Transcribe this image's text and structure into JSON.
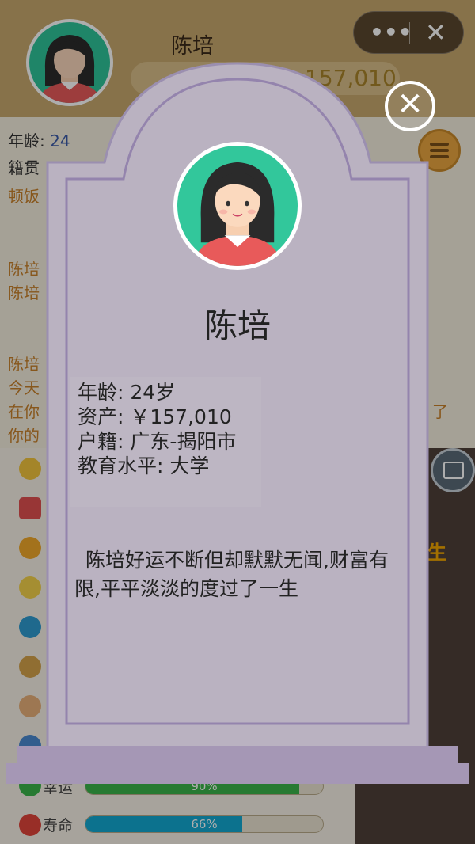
{
  "header": {
    "name": "陈培",
    "money": "157,010",
    "menu_dots": "•••",
    "close_symbol": "✕"
  },
  "info": {
    "age_label": "年龄:",
    "age_value": "24",
    "hometown_label": "籍贯",
    "log_lines": [
      "顿饭",
      "陈培",
      "陈培",
      "陈培",
      "今天",
      "在你",
      "你的"
    ],
    "log_tail": "了"
  },
  "stats": [
    {
      "label": "幸运",
      "percent_text": "90%",
      "value": 0.9,
      "icon": "clover-icon",
      "color": "#3ab44a"
    },
    {
      "label": "寿命",
      "percent_text": "66%",
      "value": 0.66,
      "icon": "heart-icon",
      "color": "#13a9d2"
    }
  ],
  "side": {
    "text": "生"
  },
  "modal": {
    "name": "陈培",
    "details": [
      "年龄: 24岁",
      "资产: ￥157,010",
      "户籍: 广东-揭阳市",
      "教育水平: 大学"
    ],
    "epitaph": "陈培好运不断但却默默无闻,财富有限,平平淡淡的度过了一生",
    "close_symbol": "✕"
  },
  "colors": {
    "tomb_fill": "#bab2c1",
    "tomb_border": "#9b8fb0",
    "base_fill": "#a597b5",
    "avatar_bg": "#32c79b"
  }
}
